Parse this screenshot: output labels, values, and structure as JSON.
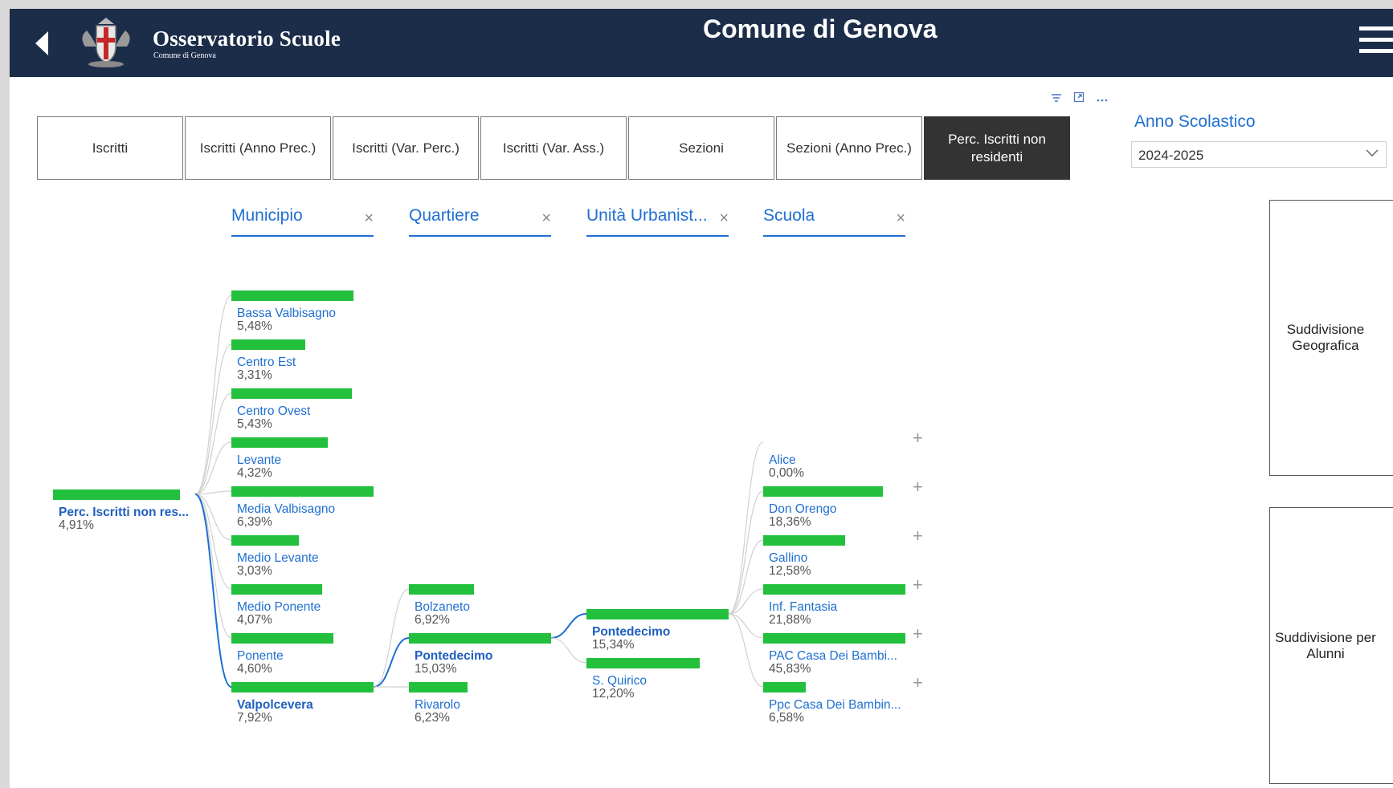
{
  "header": {
    "brand": "Osservatorio Scuole",
    "brand_sub": "Comune di Genova",
    "title": "Comune di Genova",
    "icons": [
      "back-arrow-icon",
      "coat-of-arms-icon",
      "hamburger-menu-icon"
    ]
  },
  "visual_tools": [
    "filter-icon",
    "focus-mode-icon",
    "more-options-icon"
  ],
  "tabs": [
    "Iscritti",
    "Iscritti (Anno Prec.)",
    "Iscritti (Var. Perc.)",
    "Iscritti (Var. Ass.)",
    "Sezioni",
    "Sezioni (Anno Prec.)",
    "Perc. Iscritti non residenti"
  ],
  "active_tab": "Perc. Iscritti non residenti",
  "slicer": {
    "title": "Anno Scolastico",
    "value": "2024-2025"
  },
  "side_cards": [
    "Suddivisione Geografica",
    "Suddivisione per Alunni"
  ],
  "levels": [
    "Municipio",
    "Quartiere",
    "Unità Urbanist...",
    "Scuola"
  ],
  "chart_data": {
    "type": "decomposition_tree",
    "bar_color": "#22c03c",
    "selected_color": "#1f5fbf",
    "root": {
      "label": "Perc. Iscritti non res...",
      "value": "4,91%",
      "pct": 4.91
    },
    "municipio": [
      {
        "label": "Bassa Valbisagno",
        "value": "5,48%",
        "pct": 5.48
      },
      {
        "label": "Centro Est",
        "value": "3,31%",
        "pct": 3.31
      },
      {
        "label": "Centro Ovest",
        "value": "5,43%",
        "pct": 5.43
      },
      {
        "label": "Levante",
        "value": "4,32%",
        "pct": 4.32
      },
      {
        "label": "Media Valbisagno",
        "value": "6,39%",
        "pct": 6.39
      },
      {
        "label": "Medio Levante",
        "value": "3,03%",
        "pct": 3.03
      },
      {
        "label": "Medio Ponente",
        "value": "4,07%",
        "pct": 4.07
      },
      {
        "label": "Ponente",
        "value": "4,60%",
        "pct": 4.6
      },
      {
        "label": "Valpolcevera",
        "value": "7,92%",
        "pct": 7.92,
        "selected": true
      }
    ],
    "quartiere": [
      {
        "label": "Bolzaneto",
        "value": "6,92%",
        "pct": 6.92
      },
      {
        "label": "Pontedecimo",
        "value": "15,03%",
        "pct": 15.03,
        "selected": true
      },
      {
        "label": "Rivarolo",
        "value": "6,23%",
        "pct": 6.23
      }
    ],
    "unita_urbanistica": [
      {
        "label": "Pontedecimo",
        "value": "15,34%",
        "pct": 15.34,
        "selected": true
      },
      {
        "label": "S. Quirico",
        "value": "12,20%",
        "pct": 12.2
      }
    ],
    "scuola": [
      {
        "label": "Alice",
        "value": "0,00%",
        "pct": 0
      },
      {
        "label": "Don Orengo",
        "value": "18,36%",
        "pct": 18.36
      },
      {
        "label": "Gallino",
        "value": "12,58%",
        "pct": 12.58
      },
      {
        "label": "Inf. Fantasia",
        "value": "21,88%",
        "pct": 21.88
      },
      {
        "label": "PAC Casa Dei Bambi...",
        "value": "45,83%",
        "pct": 45.83
      },
      {
        "label": "Ppc Casa Dei Bambin...",
        "value": "6,58%",
        "pct": 6.58
      }
    ]
  }
}
